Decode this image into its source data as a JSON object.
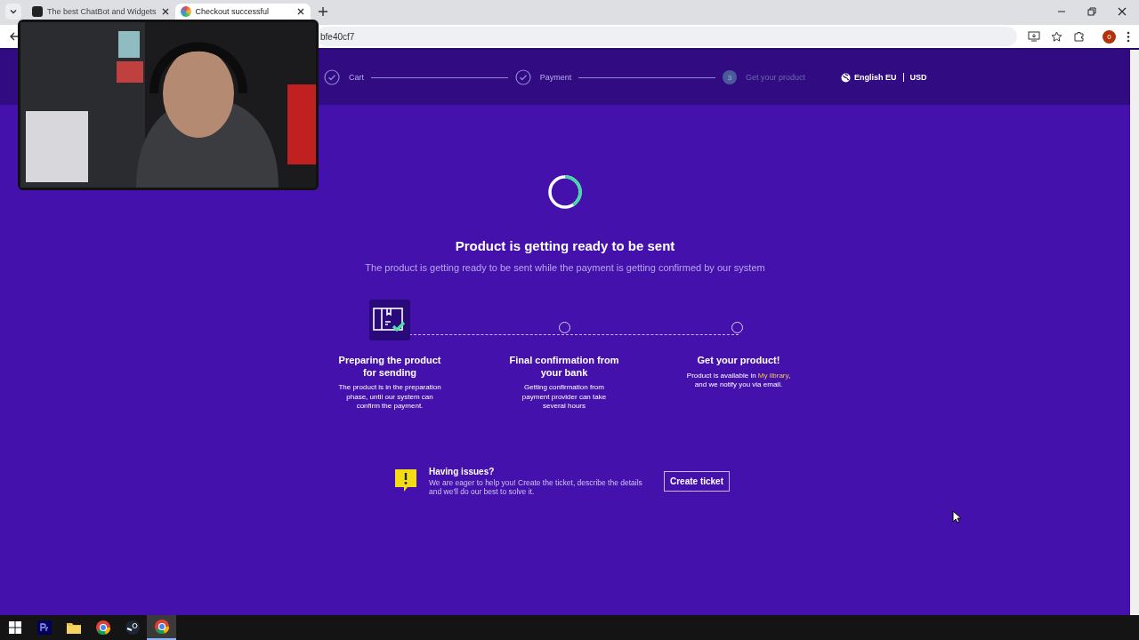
{
  "browser": {
    "tabs": [
      {
        "title": "The best ChatBot and Widgets",
        "selected": false
      },
      {
        "title": "Checkout successful",
        "selected": true
      }
    ],
    "address": "bfe40cf7",
    "profile_initial": "0"
  },
  "checkout_steps": [
    {
      "label": "Cart",
      "completed": true
    },
    {
      "label": "Payment",
      "completed": true
    },
    {
      "number": "3",
      "label": "Get your product",
      "completed": false
    }
  ],
  "locale": {
    "language": "English EU",
    "currency": "USD"
  },
  "status": {
    "title": "Product is getting ready to be sent",
    "subtitle": "The product is getting ready to be sent while the payment is getting confirmed by our system"
  },
  "progress": [
    {
      "title": "Preparing the product for sending",
      "text": "The product is in the preparation phase, until our system can confirm the payment.",
      "selected": true
    },
    {
      "title": "Final confirmation from your bank",
      "text": "Getting confirmation from payment provider can take several hours",
      "selected": false
    },
    {
      "title": "Get your product!",
      "text": "Product is available in ",
      "link": "My library",
      "text_after": ", and we notify you via email.",
      "selected": false
    }
  ],
  "help": {
    "title": "Having issues?",
    "text": "We are eager to help you! Create the ticket, describe the details and we'll do our best to solve it.",
    "button": "Create ticket"
  }
}
